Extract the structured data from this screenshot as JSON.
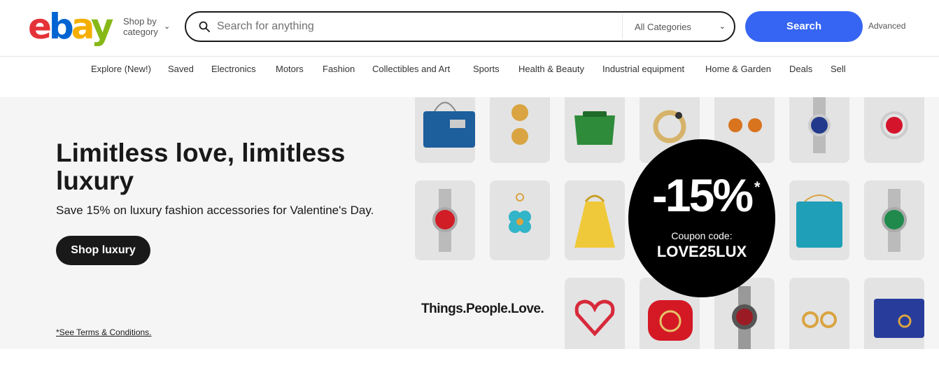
{
  "header": {
    "logo": {
      "e": "e",
      "b": "b",
      "a": "a",
      "y": "y"
    },
    "shop_by_line1": "Shop by",
    "shop_by_line2": "category",
    "search_placeholder": "Search for anything",
    "category_select": "All Categories",
    "search_button": "Search",
    "advanced_link": "Advanced"
  },
  "nav": {
    "items": [
      "Explore (New!)",
      "Saved",
      "Electronics",
      "Motors",
      "Fashion",
      "Collectibles and Art",
      "Sports",
      "Health & Beauty",
      "Industrial equipment",
      "Home & Garden",
      "Deals",
      "Sell"
    ]
  },
  "hero": {
    "title": "Limitless love, limitless luxury",
    "subtitle": "Save 15% on luxury fashion accessories for Valentine's Day.",
    "cta": "Shop luxury",
    "terms": "*See Terms & Conditions.",
    "tagline": "Things.People.Love.",
    "coupon": {
      "percent": "-15%",
      "asterisk": "*",
      "code_label": "Coupon code:",
      "code": "LOVE25LUX"
    }
  },
  "colors": {
    "brand_blue": "#3665f3",
    "logo_red": "#e53238",
    "logo_blue": "#0064d2",
    "logo_yellow": "#f5af02",
    "logo_green": "#86b817"
  },
  "icons": {
    "search": "magnifier-icon",
    "dropdown": "chevron-down-icon"
  }
}
